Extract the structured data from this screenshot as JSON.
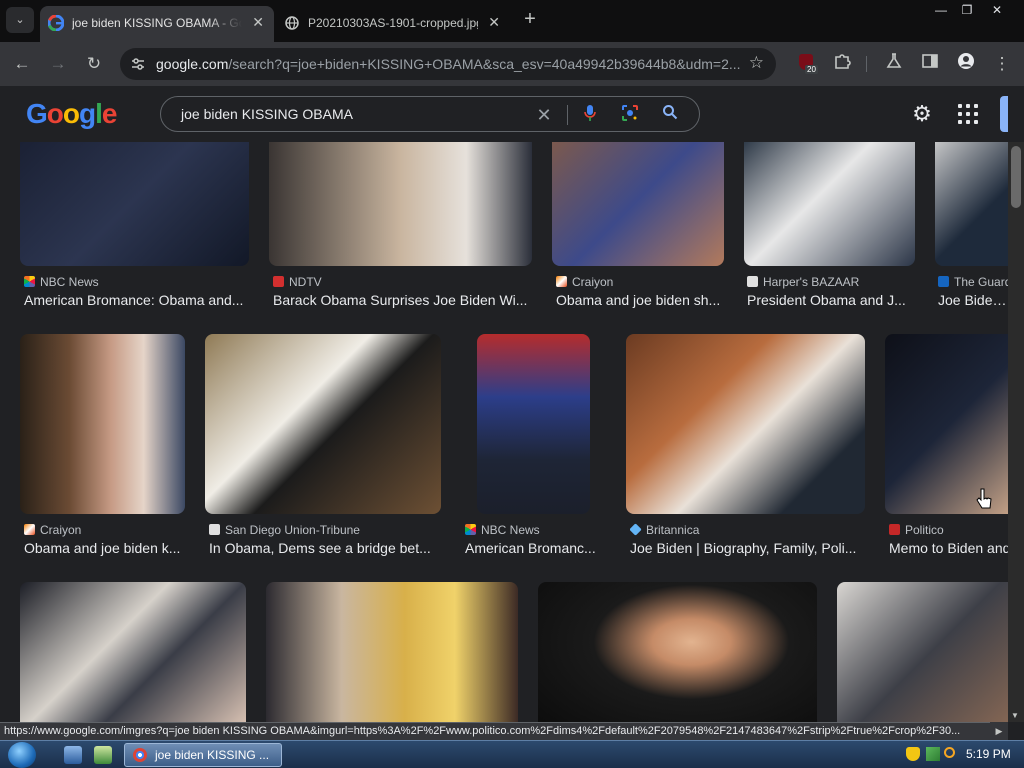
{
  "browser": {
    "tabs": [
      {
        "title": "joe biden KISSING OBAMA - Google Search",
        "active": true
      },
      {
        "title": "P20210303AS-1901-cropped.jpg",
        "active": false
      }
    ],
    "url_main": "google.com",
    "url_rest": "/search?q=joe+biden+KISSING+OBAMA&sca_esv=40a49942b39644b8&udm=2...",
    "extension_badge": "20",
    "icons": {
      "tab_menu": "chevron-down-icon",
      "back": "back-arrow-icon",
      "forward": "forward-arrow-icon",
      "reload": "reload-icon",
      "bookmark": "star-icon",
      "extensions": "puzzle-icon",
      "labs": "flask-icon",
      "sidepanel": "side-panel-icon",
      "profile": "profile-icon",
      "menu": "kebab-menu-icon"
    }
  },
  "google": {
    "logo": [
      "G",
      "o",
      "o",
      "g",
      "l",
      "e"
    ],
    "query": "joe biden KISSING OBAMA"
  },
  "results": [
    {
      "source": "NBC News",
      "title": "American Bromance: Obama and...",
      "fav_color": "#ffffff"
    },
    {
      "source": "NDTV",
      "title": "Barack Obama Surprises Joe Biden Wi...",
      "fav_color": "#d32f2f"
    },
    {
      "source": "Craiyon",
      "title": "Obama and joe biden sh...",
      "fav_color": "#f57c00"
    },
    {
      "source": "Harper's BAZAAR",
      "title": "President Obama and J...",
      "fav_color": "#e0e0e0"
    },
    {
      "source": "The Guard",
      "title": "Joe Biden: ...",
      "fav_color": "#1565c0"
    },
    {
      "source": "Craiyon",
      "title": "Obama and joe biden k...",
      "fav_color": "#f57c00"
    },
    {
      "source": "San Diego Union-Tribune",
      "title": "In Obama, Dems see a bridge bet...",
      "fav_color": "#e0e0e0"
    },
    {
      "source": "NBC News",
      "title": "American Bromanc...",
      "fav_color": "#ffffff"
    },
    {
      "source": "Britannica",
      "title": "Joe Biden | Biography, Family, Poli...",
      "fav_color": "#64b5f6"
    },
    {
      "source": "Politico",
      "title": "Memo to Biden and",
      "fav_color": "#c62828"
    }
  ],
  "status_url": "https://www.google.com/imgres?q=joe biden KISSING OBAMA&imgurl=https%3A%2F%2Fwww.politico.com%2Fdims4%2Fdefault%2F2079548%2F2147483647%2Fstrip%2Ftrue%2Fcrop%2F30...",
  "taskbar": {
    "task_label": "joe biden KISSING ...",
    "clock": "5:19 PM"
  }
}
